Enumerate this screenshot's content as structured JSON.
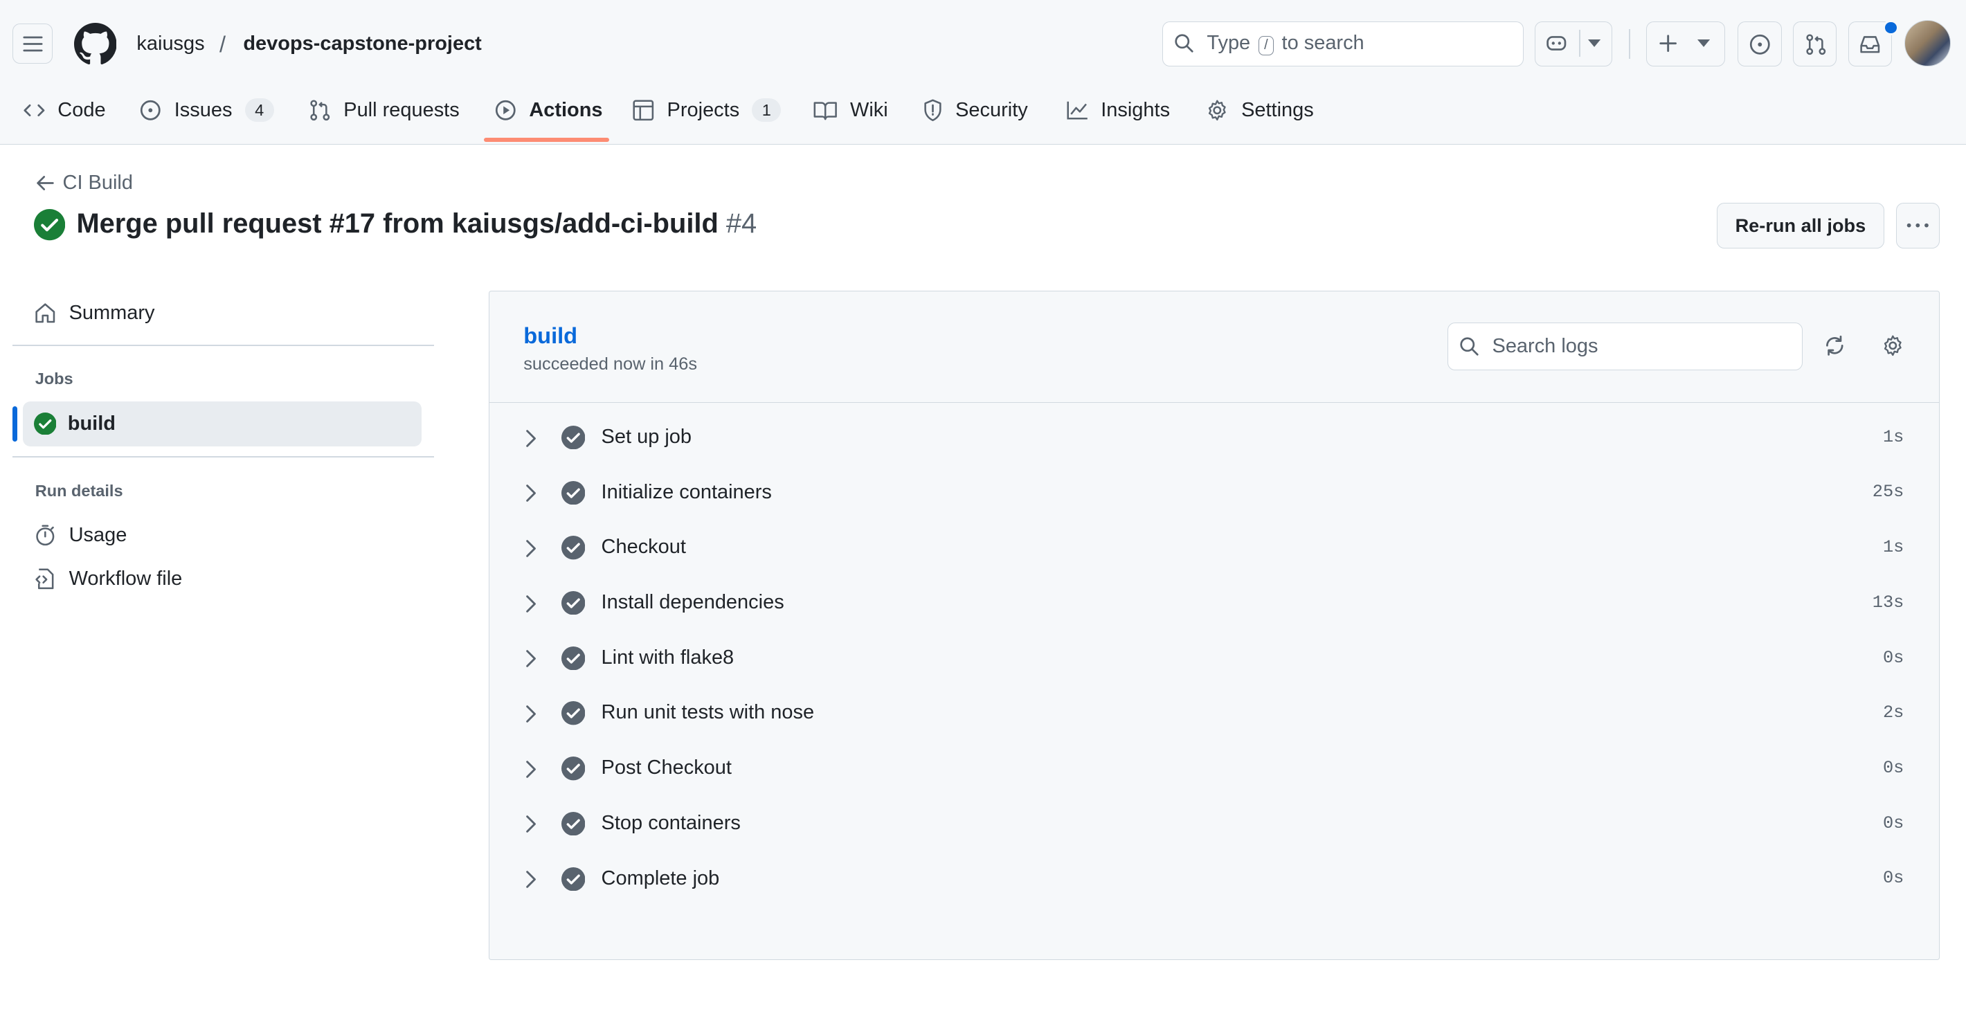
{
  "header": {
    "owner": "kaiusgs",
    "separator": "/",
    "repo": "devops-capstone-project",
    "search_prefix": "Type",
    "search_key": "/",
    "search_suffix": "to search"
  },
  "tabs": [
    {
      "label": "Code",
      "icon": "code-icon"
    },
    {
      "label": "Issues",
      "icon": "issue-icon",
      "count": "4"
    },
    {
      "label": "Pull requests",
      "icon": "pull-request-icon"
    },
    {
      "label": "Actions",
      "icon": "play-icon",
      "selected": true
    },
    {
      "label": "Projects",
      "icon": "table-icon",
      "count": "1"
    },
    {
      "label": "Wiki",
      "icon": "book-icon"
    },
    {
      "label": "Security",
      "icon": "shield-icon"
    },
    {
      "label": "Insights",
      "icon": "graph-icon"
    },
    {
      "label": "Settings",
      "icon": "gear-icon"
    }
  ],
  "run": {
    "back_label": "CI Build",
    "title": "Merge pull request #17 from kaiusgs/add-ci-build",
    "number": "#4",
    "rerun_label": "Re-run all jobs"
  },
  "sidebar": {
    "summary": "Summary",
    "jobs_heading": "Jobs",
    "job": "build",
    "run_details_heading": "Run details",
    "usage": "Usage",
    "workflow_file": "Workflow file"
  },
  "job": {
    "name": "build",
    "status": "succeeded now in 46s",
    "search_placeholder": "Search logs",
    "steps": [
      {
        "name": "Set up job",
        "duration": "1s"
      },
      {
        "name": "Initialize containers",
        "duration": "25s"
      },
      {
        "name": "Checkout",
        "duration": "1s"
      },
      {
        "name": "Install dependencies",
        "duration": "13s"
      },
      {
        "name": "Lint with flake8",
        "duration": "0s"
      },
      {
        "name": "Run unit tests with nose",
        "duration": "2s"
      },
      {
        "name": "Post Checkout",
        "duration": "0s"
      },
      {
        "name": "Stop containers",
        "duration": "0s"
      },
      {
        "name": "Complete job",
        "duration": "0s"
      }
    ]
  },
  "colors": {
    "success": "#1a7f37",
    "link": "#0969da",
    "accent_underline": "#fd8c73",
    "notification_dot": "#0969da"
  }
}
